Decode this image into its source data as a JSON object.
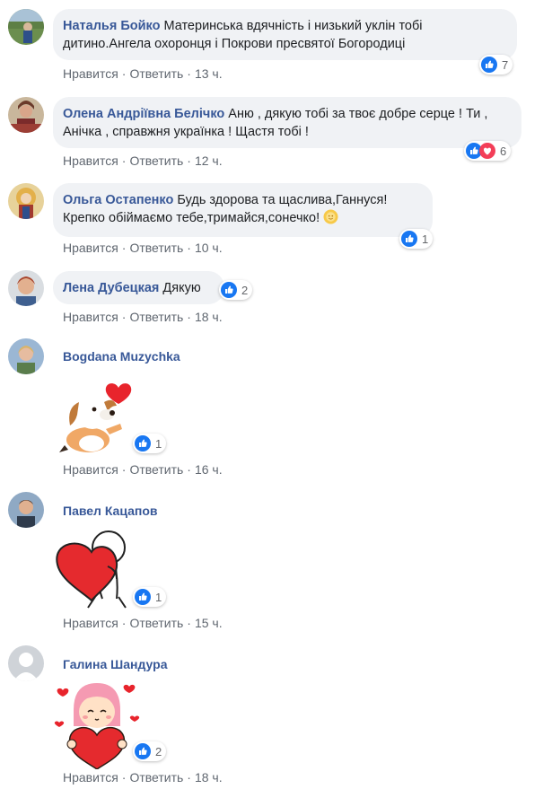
{
  "labels": {
    "like": "Нравится",
    "reply": "Ответить",
    "sep": "·"
  },
  "colors": {
    "author": "#385898",
    "like_blue": "#1877f2",
    "love_red": "#f33e58",
    "bubble": "#f0f2f5"
  },
  "comments": [
    {
      "author": "Наталья Бойко",
      "text": "Материнська вдячність і низький уклін тобі дитино.Ангела охоронця і Покрови пресвятої Богородиці",
      "time": "13 ч.",
      "reactions": [
        "like"
      ],
      "count": "7"
    },
    {
      "author": "Олена Андріївна Белічко",
      "text": "Аню , дякую тобі за твоє добре серце ! Ти , Анічка , справжня українка ! Щастя тобі !",
      "time": "12 ч.",
      "reactions": [
        "like",
        "love"
      ],
      "count": "6"
    },
    {
      "author": "Ольга Остапенко",
      "text": "Будь здорова та щаслива,Ганнуся! Крепко обіймаємо тебе,тримайся,сонечко!",
      "emoji": "sun-face-emoji",
      "time": "10 ч.",
      "reactions": [
        "like"
      ],
      "count": "1"
    },
    {
      "author": "Лена Дубецкая",
      "text": "Дякую",
      "time": "18 ч.",
      "reactions": [
        "like"
      ],
      "count": "2"
    },
    {
      "author": "Bogdana Muzychka",
      "sticker": "dog-heart-sticker",
      "time": "16 ч.",
      "reactions": [
        "like"
      ],
      "count": "1"
    },
    {
      "author": "Павел Кацапов",
      "sticker": "hug-heart-sticker",
      "time": "15 ч.",
      "reactions": [
        "like"
      ],
      "count": "1"
    },
    {
      "author": "Галина Шандура",
      "sticker": "girl-heart-sticker",
      "time": "18 ч.",
      "reactions": [
        "like"
      ],
      "count": "2"
    }
  ]
}
